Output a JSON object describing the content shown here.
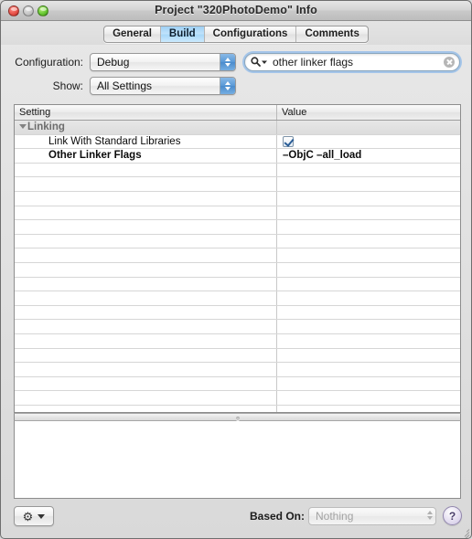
{
  "window": {
    "title": "Project \"320PhotoDemo\" Info",
    "controls": [
      {
        "name": "close-button",
        "icon": "close-traffic-light"
      },
      {
        "name": "minimize-button",
        "icon": "minimize-traffic-light"
      },
      {
        "name": "zoom-button",
        "icon": "zoom-traffic-light"
      }
    ]
  },
  "tabs": [
    {
      "label": "General",
      "active": false
    },
    {
      "label": "Build",
      "active": true
    },
    {
      "label": "Configurations",
      "active": false
    },
    {
      "label": "Comments",
      "active": false
    }
  ],
  "config": {
    "configuration_label": "Configuration:",
    "configuration_value": "Debug",
    "show_label": "Show:",
    "show_value": "All Settings",
    "search_value": "other linker flags",
    "search_placeholder": "Search",
    "search_icon": "magnifier-icon",
    "clear_icon": "clear-circle-icon"
  },
  "table": {
    "columns": [
      "Setting",
      "Value"
    ],
    "rows": [
      {
        "type": "group",
        "setting": "Linking",
        "value": "",
        "disclosure": "triangle-down-icon"
      },
      {
        "type": "item",
        "setting": "Link With Standard Libraries",
        "value": "",
        "checkbox": true,
        "bold": false
      },
      {
        "type": "item",
        "setting": "Other Linker Flags",
        "value": "–ObjC –all_load",
        "checkbox": false,
        "bold": true
      },
      {
        "type": "empty",
        "setting": "",
        "value": ""
      },
      {
        "type": "empty",
        "setting": "",
        "value": ""
      },
      {
        "type": "empty",
        "setting": "",
        "value": ""
      },
      {
        "type": "empty",
        "setting": "",
        "value": ""
      },
      {
        "type": "empty",
        "setting": "",
        "value": ""
      },
      {
        "type": "empty",
        "setting": "",
        "value": ""
      },
      {
        "type": "empty",
        "setting": "",
        "value": ""
      },
      {
        "type": "empty",
        "setting": "",
        "value": ""
      },
      {
        "type": "empty",
        "setting": "",
        "value": ""
      },
      {
        "type": "empty",
        "setting": "",
        "value": ""
      },
      {
        "type": "empty",
        "setting": "",
        "value": ""
      },
      {
        "type": "empty",
        "setting": "",
        "value": ""
      },
      {
        "type": "empty",
        "setting": "",
        "value": ""
      },
      {
        "type": "empty",
        "setting": "",
        "value": ""
      },
      {
        "type": "empty",
        "setting": "",
        "value": ""
      },
      {
        "type": "empty",
        "setting": "",
        "value": ""
      },
      {
        "type": "empty",
        "setting": "",
        "value": ""
      },
      {
        "type": "empty",
        "setting": "",
        "value": ""
      },
      {
        "type": "empty",
        "setting": "",
        "value": ""
      }
    ]
  },
  "bottom": {
    "gear_icon": "gear-icon",
    "gear_caret": "chevron-down-icon",
    "based_on_label": "Based On:",
    "based_on_value": "Nothing",
    "help_label": "?"
  },
  "colors": {
    "accent_blue": "#5b9ad8",
    "selected_tab": "#a9d8f8",
    "help_purple": "#cfc6e4",
    "group_row": "#e0e0e0"
  }
}
